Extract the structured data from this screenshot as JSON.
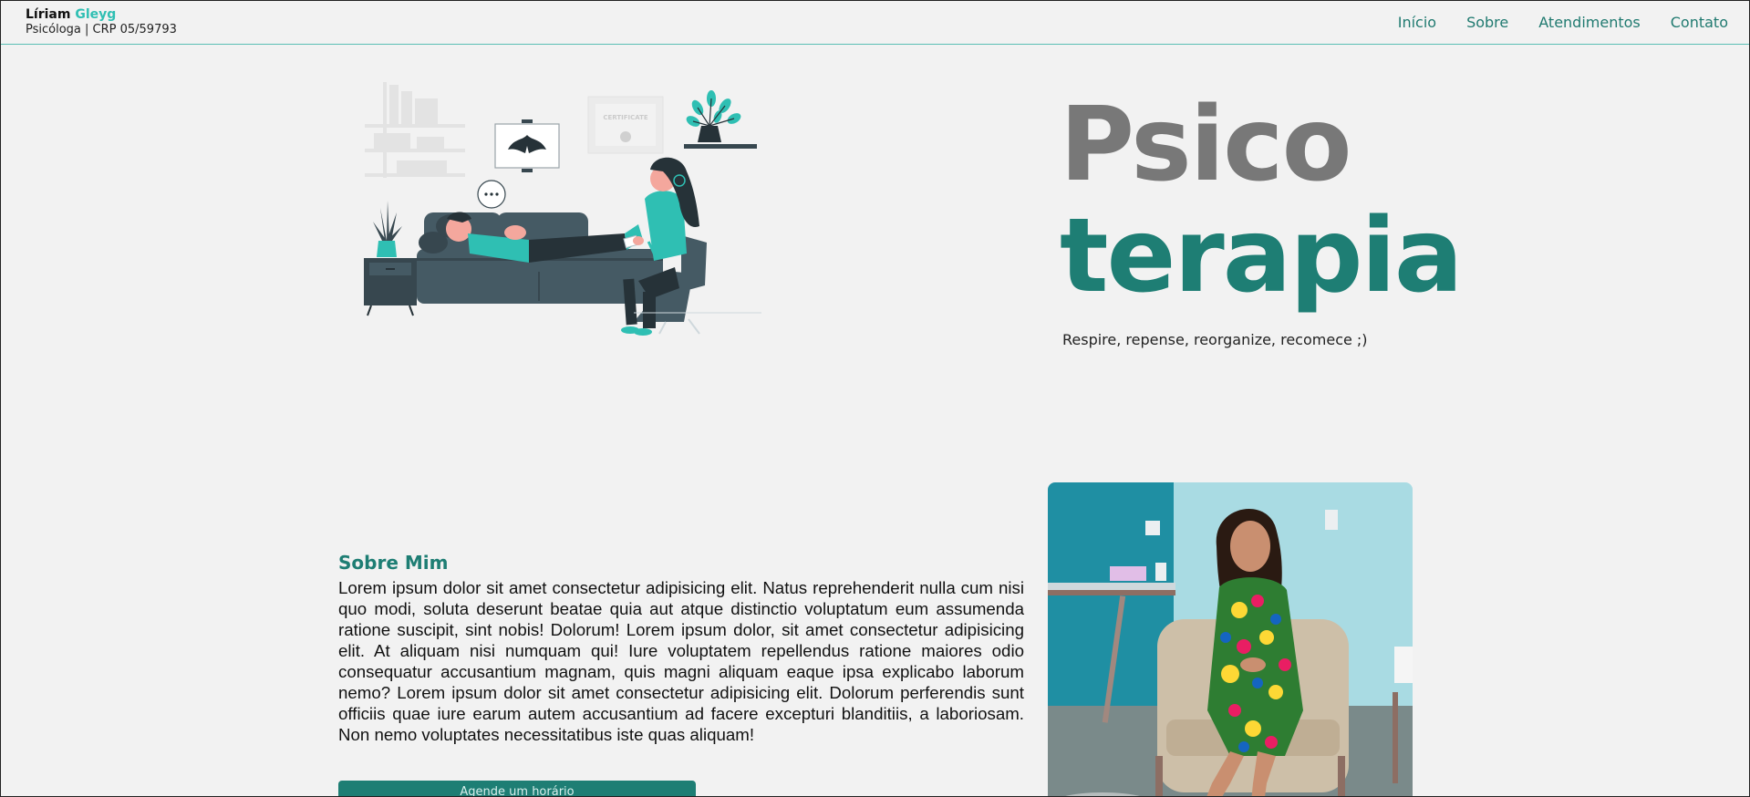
{
  "brand": {
    "first_name": "Líriam",
    "last_name": "Gleyg",
    "subtitle": "Psicóloga | CRP 05/59793"
  },
  "nav": {
    "items": [
      {
        "label": "Início"
      },
      {
        "label": "Sobre"
      },
      {
        "label": "Atendimentos"
      },
      {
        "label": "Contato"
      }
    ]
  },
  "hero": {
    "title_line1": "Psico",
    "title_line2": "terapia",
    "subtitle": "Respire, repense, reorganize, recomece ;)",
    "certificate_label": "CERTIFICATE"
  },
  "about": {
    "title": "Sobre Mim",
    "text": "Lorem ipsum dolor sit amet consectetur adipisicing elit. Natus reprehenderit nulla cum nisi quo modi, soluta deserunt beatae quia aut atque distinctio voluptatum eum assumenda ratione suscipit, sint nobis! Dolorum! Lorem ipsum dolor, sit amet consectetur adipisicing elit. At aliquam nisi numquam qui! Iure voluptatem repellendus ratione maiores odio consequatur accusantium magnam, quis magni aliquam eaque ipsa explicabo laborum nemo? Lorem ipsum dolor sit amet consectetur adipisicing elit. Dolorum perferendis sunt officiis quae iure earum autem accusantium ad facere excepturi blanditiis, a laboriosam. Non nemo voluptates necessitatibus iste quas aliquam!",
    "cta_label": "Agende um horário"
  },
  "colors": {
    "accent": "#1e7e74",
    "accent_light": "#2fbfb3",
    "title_gray": "#787878",
    "background": "#f2f2f2"
  }
}
